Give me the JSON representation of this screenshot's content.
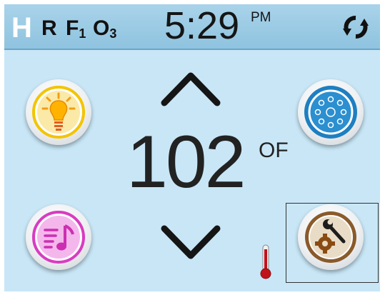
{
  "status": {
    "heater": "H",
    "recirc": "R",
    "filter": "F",
    "filter_num": "1",
    "ozone": "O",
    "ozone_num": "3",
    "time": "5:29",
    "ampm": "PM",
    "sync_icon": "sync-icon"
  },
  "temperature": {
    "value": "102",
    "unit": "OF"
  },
  "controls": {
    "light_icon": "lightbulb-icon",
    "jets_icon": "jets-icon",
    "music_icon": "music-icon",
    "settings_icon": "settings-icon",
    "up_icon": "chevron-up-icon",
    "down_icon": "chevron-down-icon",
    "thermometer_icon": "thermometer-icon"
  },
  "colors": {
    "background": "#c8e6f6",
    "status_bar": "#9fcde6",
    "light_ring": "#f3c400",
    "jets_ring": "#1e7fc1",
    "music_ring": "#d93bc2",
    "settings_ring": "#8a5a2a",
    "thermometer": "#c0121b"
  }
}
